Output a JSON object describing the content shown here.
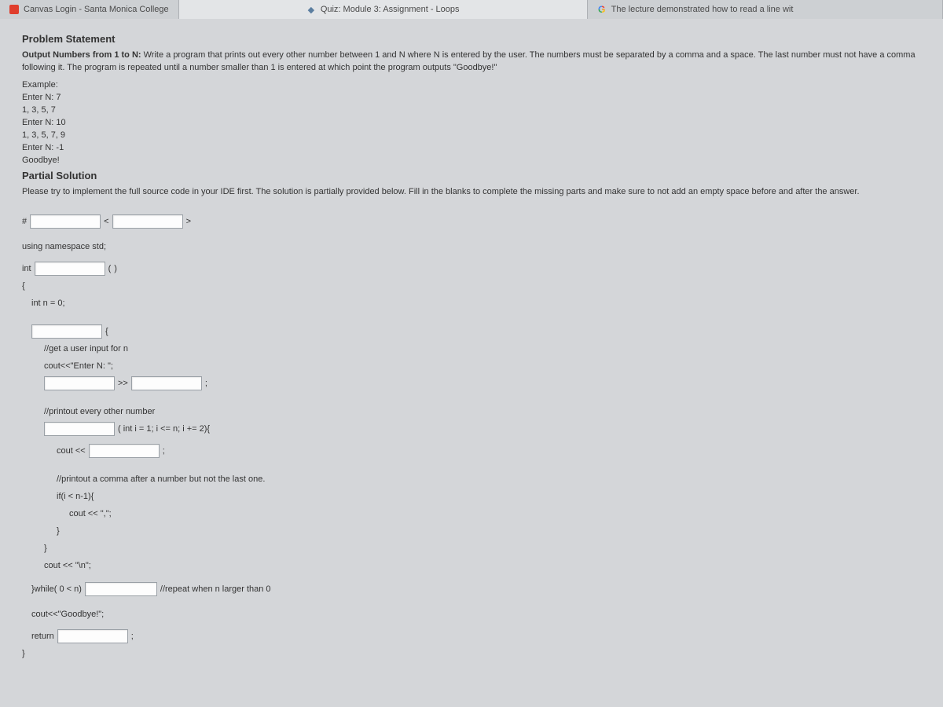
{
  "tabs": {
    "t0": {
      "label": "Canvas Login - Santa Monica College"
    },
    "t1": {
      "label": "Quiz: Module 3: Assignment - Loops"
    },
    "t2": {
      "label": "The lecture demonstrated how to read a line wit"
    }
  },
  "sections": {
    "problem_title": "Problem Statement",
    "partial_title": "Partial Solution"
  },
  "problem": {
    "lead_bold": "Output Numbers from 1 to N:",
    "lead_rest": " Write a program that prints out every other number between 1 and N where N is entered by the user. The numbers must be separated by a comma and a space. The last number must not have a comma following it. The program is repeated until a number smaller than 1 is entered at which point the program outputs \"Goodbye!\""
  },
  "example": {
    "l0": "Example:",
    "l1": "Enter N: 7",
    "l2": "1, 3, 5, 7",
    "l3": "Enter N: 10",
    "l4": "1, 3, 5, 7, 9",
    "l5": "Enter N: -1",
    "l6": "Goodbye!"
  },
  "partial_instr": "Please try to implement the full source code in your IDE first. The solution is partially provided below. Fill in the blanks to complete the missing parts and make sure to not add an empty space before and after the answer.",
  "code": {
    "hash": "#",
    "lt": "<",
    "gt": ">",
    "using": "using namespace std;",
    "int_kw": "int",
    "paren_open": "(",
    "paren_close": ")",
    "brace_open": "{",
    "brace_close": "}",
    "intn": "int n = 0;",
    "c_getinput": "//get a user input for n",
    "cout_enter": "cout<<\"Enter N: \";",
    "rshift": ">>",
    "semicolon": ";",
    "c_printevery": "//printout every other number",
    "for_tail": "( int i = 1; i <= n; i += 2){",
    "cout_ll": "cout <<",
    "c_comma": "//printout a comma after a number but not the last one.",
    "if_line": "if(i < n-1){",
    "cout_comma": "cout << \",\";",
    "cout_nl": "cout << \"\\n\";",
    "while_head": "}while( 0 < n)",
    "c_repeat": "//repeat when n larger than 0",
    "cout_bye": "cout<<\"Goodbye!\";",
    "return_kw": "return"
  }
}
